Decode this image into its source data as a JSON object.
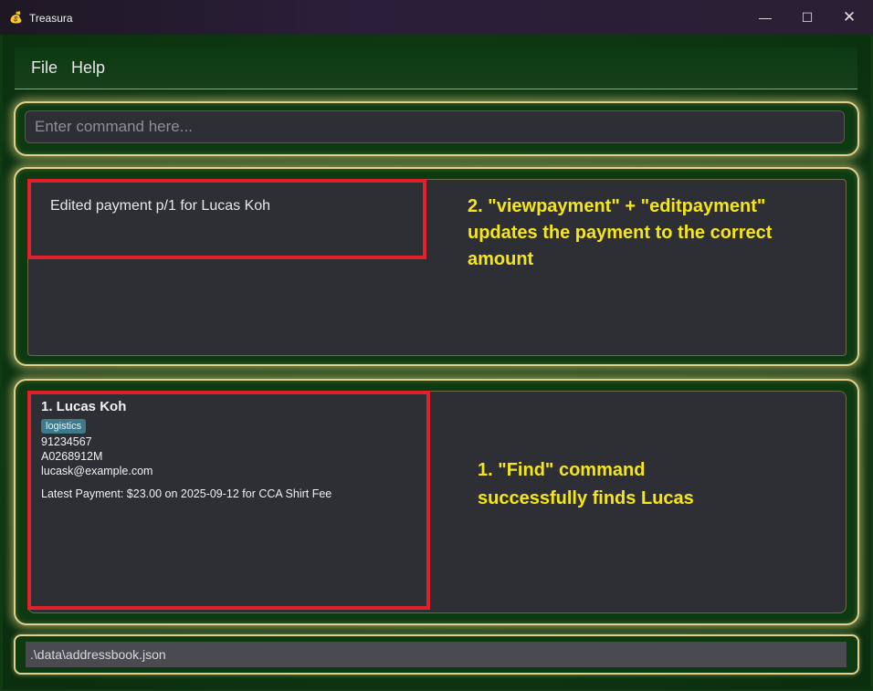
{
  "window": {
    "title": "Treasura",
    "minimize_glyph": "—",
    "maximize_glyph": "☐",
    "close_glyph": "✕"
  },
  "menu": {
    "items": [
      "File",
      "Help"
    ]
  },
  "command": {
    "placeholder": "Enter command here...",
    "value": ""
  },
  "result": {
    "text": "Edited payment p/1 for Lucas Koh"
  },
  "person_list": [
    {
      "index_name": "1. Lucas Koh",
      "tags": [
        "logistics"
      ],
      "phone": "91234567",
      "matric": "A0268912M",
      "email": "lucask@example.com",
      "latest_payment": "Latest Payment: $23.00 on 2025-09-12 for CCA Shirt Fee"
    }
  ],
  "status": {
    "path": ".\\data\\addressbook.json"
  },
  "annotations": {
    "result_note": [
      "2. \"viewpayment\" + \"editpayment\"",
      "updates the payment to the correct",
      "amount"
    ],
    "list_note": [
      "1. \"Find\" command",
      "successfully finds Lucas"
    ]
  },
  "colors": {
    "accent_gold": "#e0d08a",
    "highlight_red": "#e0202a",
    "annotation_yellow": "#f5e61a",
    "background_green": "#0e3a12",
    "tag_blue": "#3e7a8a"
  },
  "icons": {
    "app_icon": "money-bag-icon"
  }
}
